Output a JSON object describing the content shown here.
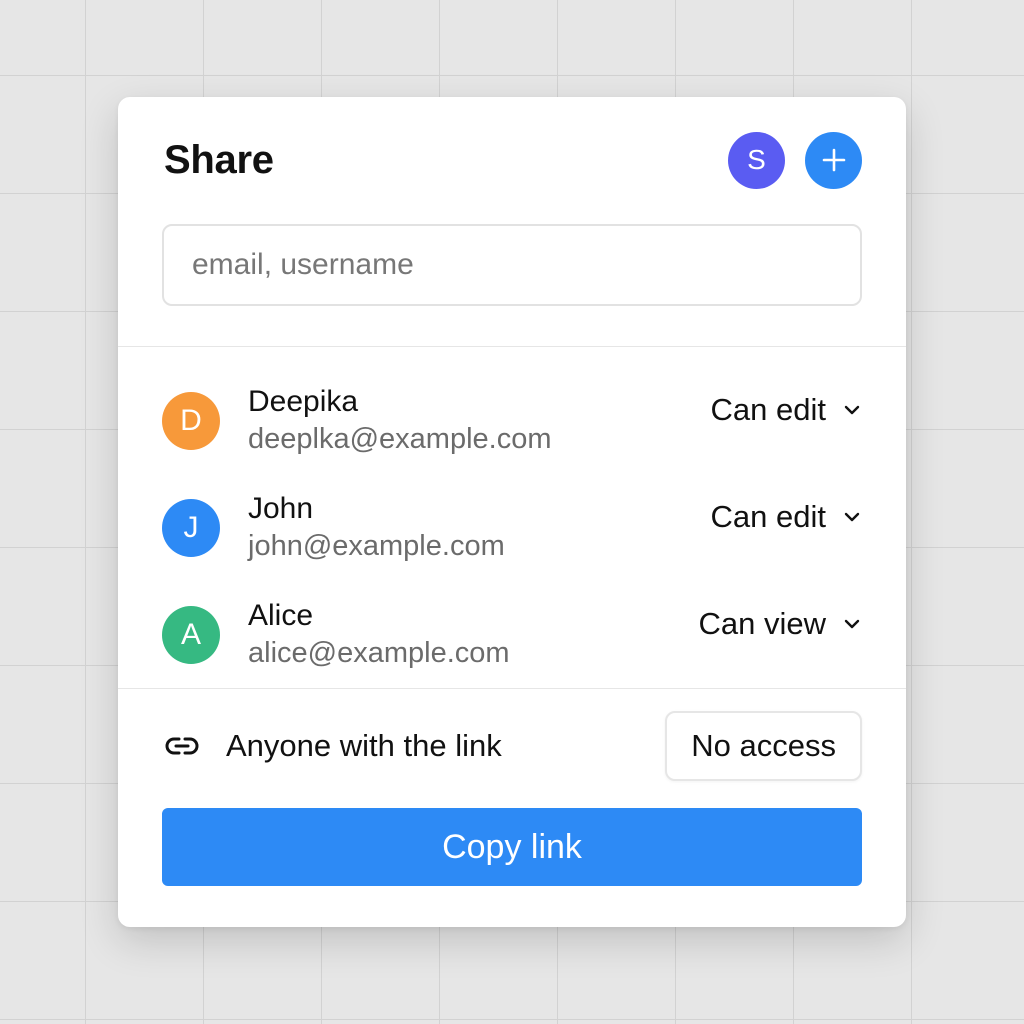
{
  "dialog": {
    "title": "Share",
    "owner_avatar_initial": "S",
    "owner_avatar_color": "#5a5cf2",
    "add_button_icon": "plus-icon",
    "add_button_color": "#2d8af5"
  },
  "search": {
    "placeholder": "email, username",
    "value": ""
  },
  "members": [
    {
      "initial": "D",
      "name": "Deepika",
      "email": "deeplka@example.com",
      "role": "Can edit",
      "color": "#f7993a"
    },
    {
      "initial": "J",
      "name": "John",
      "email": "john@example.com",
      "role": "Can edit",
      "color": "#2d8af5"
    },
    {
      "initial": "A",
      "name": "Alice",
      "email": "alice@example.com",
      "role": "Can view",
      "color": "#36b982"
    }
  ],
  "link_access": {
    "icon": "link-icon",
    "label": "Anyone with the link",
    "access": "No access"
  },
  "copy_button": {
    "label": "Copy link",
    "color": "#2d8af5"
  }
}
